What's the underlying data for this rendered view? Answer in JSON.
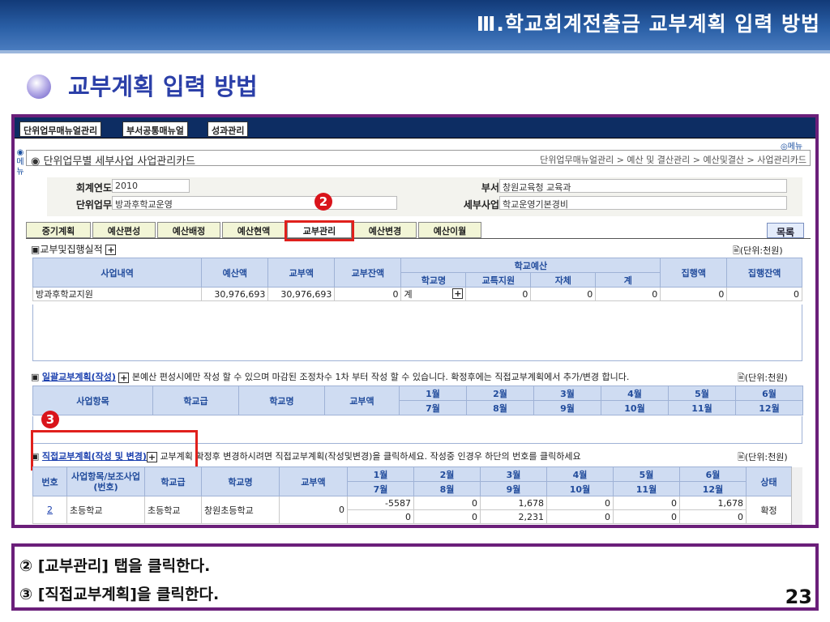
{
  "slide": {
    "title": "Ⅲ.학교회계전출금 교부계획 입력 방법",
    "subtitle": "교부계획 입력 방법",
    "page": "23"
  },
  "menubar": {
    "tabs": [
      "단위업무매뉴얼관리",
      "부서공통매뉴얼",
      "성과관리"
    ],
    "menu": "◎메뉴",
    "side": "메뉴"
  },
  "header": {
    "title": "◉ 단위업무별 세부사업 사업관리카드",
    "breadcrumb": "단위업무매뉴얼관리 > 예산 및 결산관리 > 예산및결산 > 사업관리카드"
  },
  "form": {
    "year_label": "회계연도",
    "year_value": "2010",
    "unit_label": "단위업무",
    "unit_value": "방과후학교운영",
    "dept_label": "부서",
    "dept_value": "창원교육청 교육과",
    "detail_label": "세부사업",
    "detail_value": "학교운영기본경비"
  },
  "tabs": [
    "중기계획",
    "예산편성",
    "예산배정",
    "예산현액",
    "교부관리",
    "예산변경",
    "예산이월"
  ],
  "list_button": "목록",
  "unit_text": "(단위:천원)",
  "sec1": {
    "title": "교부및집행실적",
    "headers": {
      "c1": "사업내역",
      "c2": "예산액",
      "c3": "교부액",
      "c4": "교부잔액",
      "group": "학교예산",
      "g1": "학교명",
      "g2": "교특지원",
      "g3": "자체",
      "g4": "계",
      "c5": "집행액",
      "c6": "집행잔액"
    },
    "row": [
      "방과후학교지원",
      "30,976,693",
      "30,976,693",
      "0",
      "계",
      "0",
      "0",
      "0",
      "0",
      "0"
    ]
  },
  "sec2": {
    "title": "일괄교부계획(작성)",
    "note": "본예산 편성시에만 작성 할 수 있으며 마감된 조정차수 1차 부터 작성 할 수 있습니다. 확정후에는 직접교부계획에서 추가/변경 합니다.",
    "headers": [
      "사업항목",
      "학교급",
      "학교명",
      "교부액"
    ],
    "months_top": [
      "1월",
      "2월",
      "3월",
      "4월",
      "5월",
      "6월"
    ],
    "months_bottom": [
      "7월",
      "8월",
      "9월",
      "10월",
      "11월",
      "12월"
    ]
  },
  "sec3": {
    "title": "직접교부계획(작성 및 변경)",
    "note": "교부계획 확정후 변경하시려면 직접교부계획(작성및변경)을 클릭하세요. 작성중 인경우 하단의 번호를 클릭하세요",
    "headers": {
      "no": "번호",
      "item": "사업항목/보조사업(번호)",
      "level": "학교급",
      "school": "학교명",
      "amount": "교부액",
      "status": "상태"
    },
    "row": {
      "no": "2",
      "item": "초등학교",
      "level": "초등학교",
      "school": "창원초등학교",
      "amount": "0",
      "m1": [
        "-5587",
        "0",
        "1,678",
        "0",
        "0",
        "1,678"
      ],
      "m2": [
        "0",
        "0",
        "2,231",
        "0",
        "0",
        "0"
      ],
      "status": "확정"
    }
  },
  "markers": {
    "m2": "2",
    "m3": "3"
  },
  "notes": {
    "line1": "② [교부관리] 탭을 클릭한다.",
    "line2": "③ [직접교부계획]을 클릭한다."
  }
}
